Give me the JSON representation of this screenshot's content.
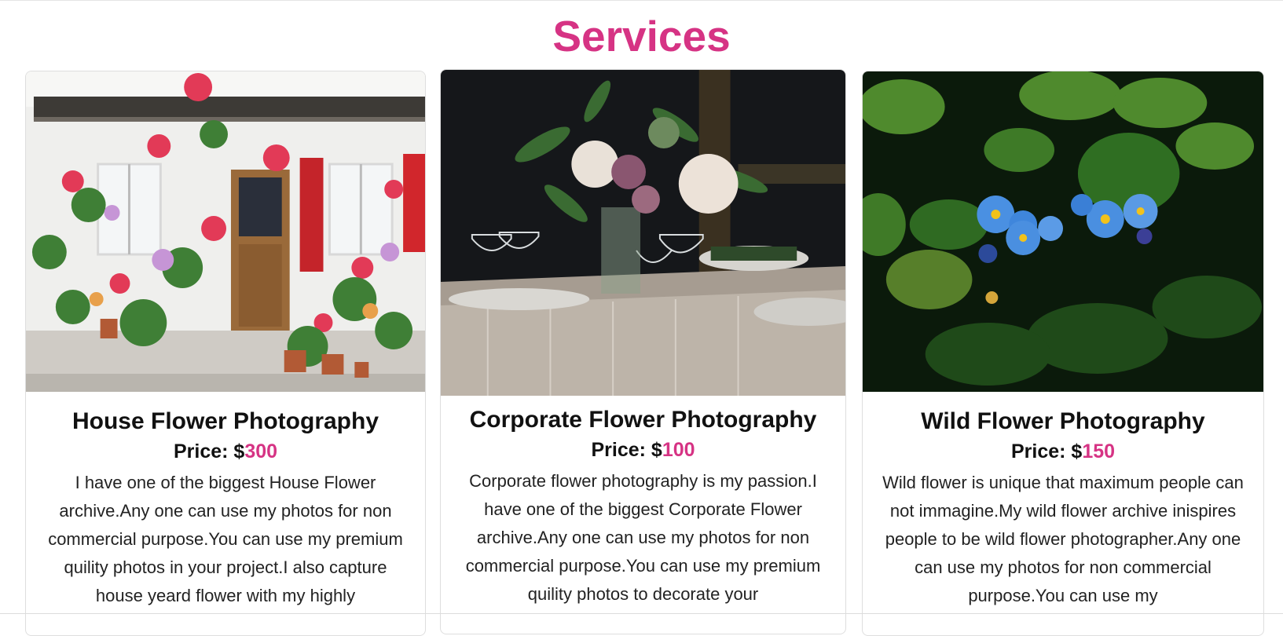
{
  "section": {
    "title": "Services"
  },
  "cards": [
    {
      "title": "House Flower Photography",
      "price_label": "Price: $",
      "price_value": "300",
      "description": "I have one of the biggest House Flower archive.Any one can use my photos for non commercial purpose.You can use my premium quility photos in your project.I also capture house yeard flower with my highly"
    },
    {
      "title": "Corporate Flower Photography",
      "price_label": "Price: $",
      "price_value": "100",
      "description": "Corporate flower photography is my passion.I have one of the biggest Corporate Flower archive.Any one can use my photos for non commercial purpose.You can use my premium quility photos to decorate your"
    },
    {
      "title": "Wild Flower Photography",
      "price_label": "Price: $",
      "price_value": "150",
      "description": "Wild flower is unique that maximum people can not immagine.My wild flower archive inispires people to be wild flower photographer.Any one can use my photos for non commercial purpose.You can use my"
    }
  ],
  "colors": {
    "accent": "#d63384",
    "text": "#111111"
  }
}
